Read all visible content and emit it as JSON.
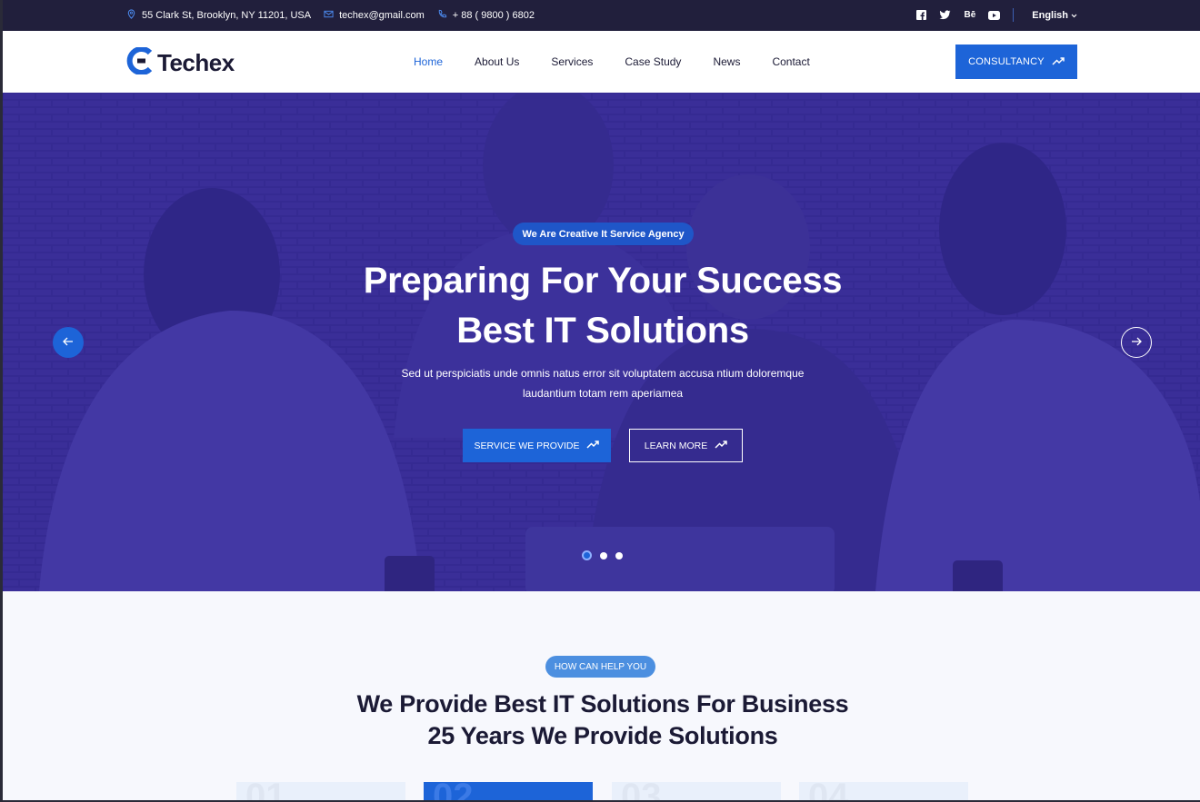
{
  "topbar": {
    "address": "55 Clark St, Brooklyn, NY 11201, USA",
    "email": "techex@gmail.com",
    "phone": "+ 88 ( 9800 ) 6802",
    "socials": [
      "facebook-icon",
      "twitter-icon",
      "behance-icon",
      "youtube-icon"
    ],
    "language": "English"
  },
  "header": {
    "logo_text": "Techex",
    "nav": [
      {
        "label": "Home",
        "active": true
      },
      {
        "label": "About Us"
      },
      {
        "label": "Services"
      },
      {
        "label": "Case Study"
      },
      {
        "label": "News"
      },
      {
        "label": "Contact"
      }
    ],
    "cta_label": "CONSULTANCY"
  },
  "hero": {
    "badge": "We Are Creative It Service Agency",
    "title_line1": "Preparing For Your Success",
    "title_line2": "Best IT Solutions",
    "desc_line1": "Sed ut perspiciatis unde omnis natus error sit voluptatem accusa ntium doloremque",
    "desc_line2": "laudantium totam rem aperiamea",
    "primary_btn": "SERVICE WE PROVIDE",
    "secondary_btn": "LEARN MORE",
    "slides_count": 3,
    "active_slide": 1
  },
  "help": {
    "badge": "HOW CAN HELP YOU",
    "title_line1": "We Provide Best IT Solutions For Business",
    "title_line2": "25 Years We Provide Solutions",
    "cards": [
      {
        "number": "01",
        "active": false
      },
      {
        "number": "02",
        "active": true
      },
      {
        "number": "03",
        "active": false
      },
      {
        "number": "04",
        "active": false
      }
    ]
  },
  "colors": {
    "primary": "#1d64d8",
    "dark": "#211f3c",
    "hero_overlay": "#3d3194",
    "text_dark": "#1b1a35"
  }
}
